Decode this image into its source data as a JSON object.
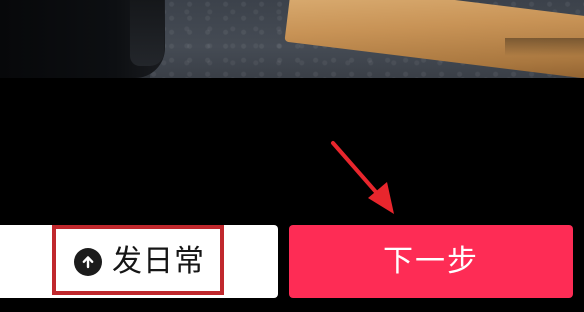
{
  "preview": {
    "description_icon": "video-preview"
  },
  "actions": {
    "daily_button": {
      "icon": "upload-arrow-icon",
      "label": "发日常"
    },
    "next_button": {
      "label": "下一步"
    }
  },
  "colors": {
    "next_button_bg": "#fe2c55",
    "highlight_border": "#c0282d",
    "arrow": "#e8262d",
    "background": "#000000"
  }
}
